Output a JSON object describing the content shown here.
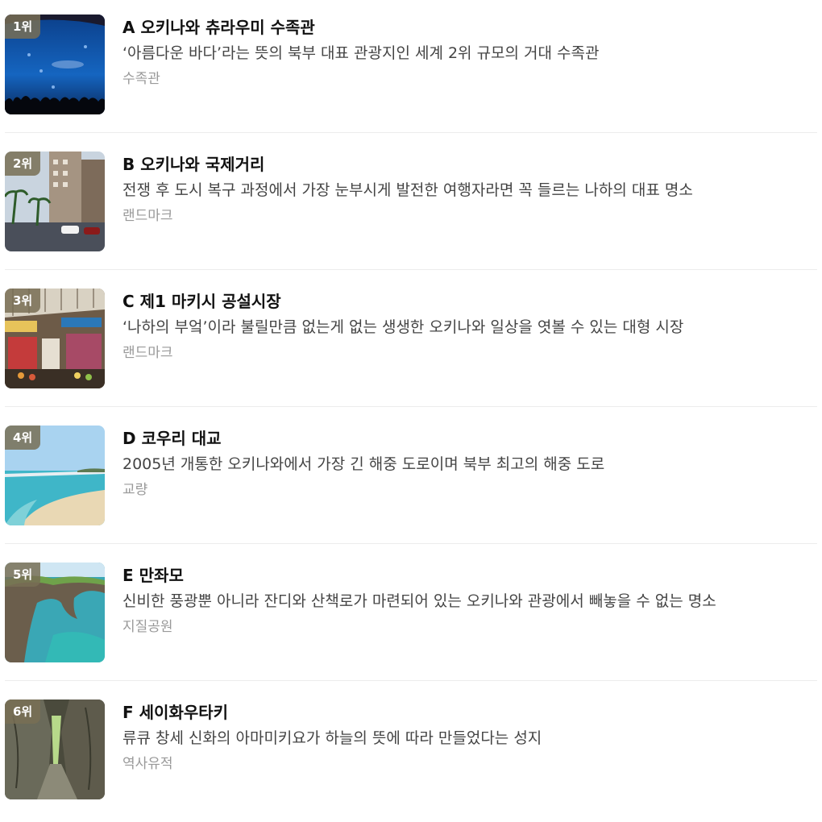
{
  "items": [
    {
      "rank": "1위",
      "letter": "A",
      "name": "오키나와 츄라우미 수족관",
      "description": "‘아름다운 바다’라는 뜻의 북부 대표 관광지인 세계 2위 규모의 거대 수족관",
      "category": "수족관"
    },
    {
      "rank": "2위",
      "letter": "B",
      "name": "오키나와 국제거리",
      "description": "전쟁 후 도시 복구 과정에서 가장 눈부시게 발전한 여행자라면 꼭 들르는 나하의 대표 명소",
      "category": "랜드마크"
    },
    {
      "rank": "3위",
      "letter": "C",
      "name": "제1 마키시 공설시장",
      "description": "‘나하의 부엌’이라 불릴만큼 없는게 없는 생생한 오키나와 일상을 엿볼 수 있는 대형 시장",
      "category": "랜드마크"
    },
    {
      "rank": "4위",
      "letter": "D",
      "name": "코우리 대교",
      "description": "2005년 개통한 오키나와에서 가장 긴 해중 도로이며 북부 최고의 해중 도로",
      "category": "교량"
    },
    {
      "rank": "5위",
      "letter": "E",
      "name": "만좌모",
      "description": "신비한 풍광뿐 아니라 잔디와 산책로가 마련되어 있는 오키나와 관광에서 빼놓을 수 없는 명소",
      "category": "지질공원"
    },
    {
      "rank": "6위",
      "letter": "F",
      "name": "세이화우타키",
      "description": "류큐 창세 신화의 아마미키요가 하늘의 뜻에 따라 만들었다는 성지",
      "category": "역사유적"
    }
  ],
  "colors": {
    "badge": "#786e55",
    "title": "#111111",
    "description": "#444444",
    "category": "#999999"
  }
}
